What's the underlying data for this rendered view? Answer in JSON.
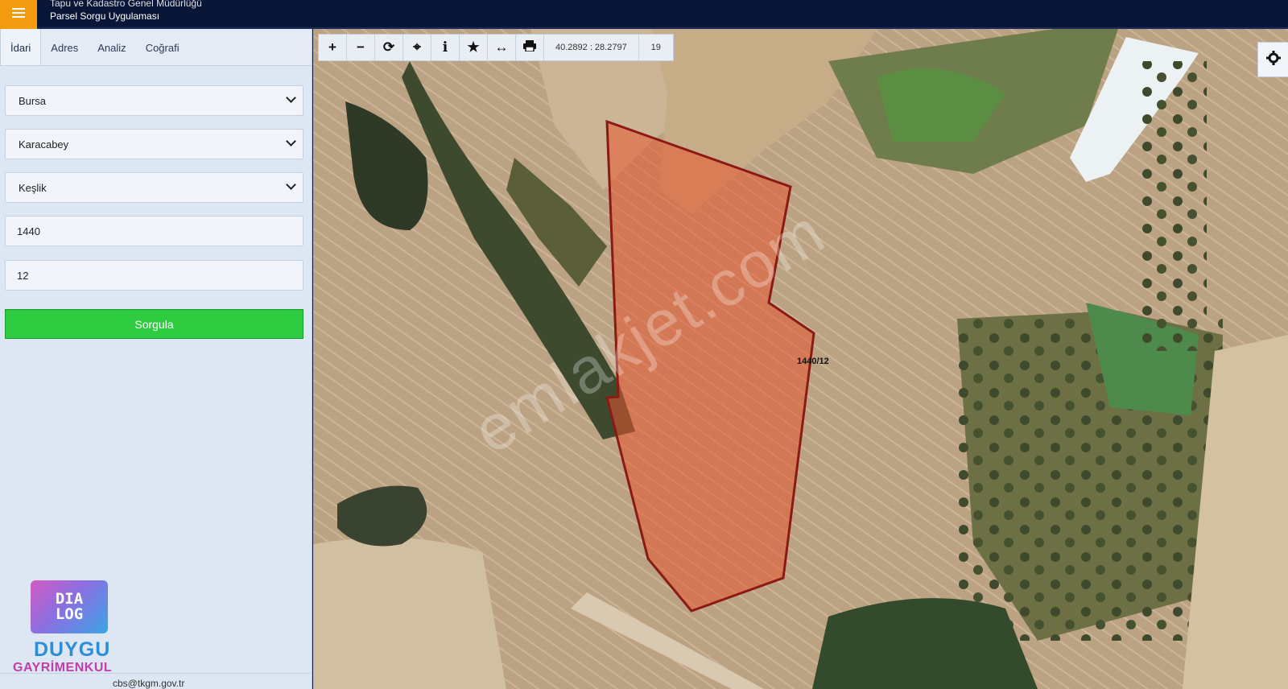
{
  "header": {
    "org_title": "Tapu ve Kadastro Genel Müdürlüğü",
    "app_title": "Parsel Sorgu Uygulaması"
  },
  "sidebar": {
    "tabs": [
      {
        "label": "İdari"
      },
      {
        "label": "Adres"
      },
      {
        "label": "Analiz"
      },
      {
        "label": "Coğrafi"
      }
    ],
    "province": "Bursa",
    "district": "Karacabey",
    "neighborhood": "Keşlik",
    "block_no": "1440",
    "parcel_no": "12",
    "query_label": "Sorgula",
    "footer_email": "cbs@tkgm.gov.tr"
  },
  "logo": {
    "line1": "DIA",
    "line2": "LOG",
    "name": "DUYGU",
    "sub": "GAYRİMENKUL"
  },
  "map": {
    "coordinates": "40.2892 : 28.2797",
    "zoom": "19",
    "parcel_label": "1440/12",
    "watermark": "emlakjet.com"
  },
  "colors": {
    "accent": "#f39c12",
    "query_button": "#2ecc40",
    "parcel_fill": "#e8552f",
    "parcel_border": "#8b1a14"
  }
}
